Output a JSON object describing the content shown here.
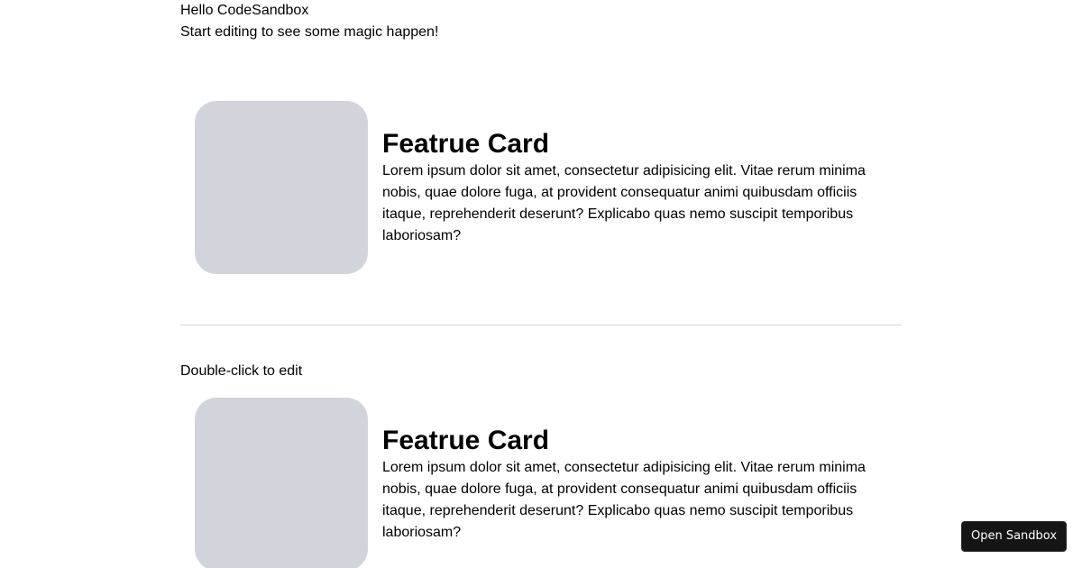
{
  "header": {
    "greeting": "Hello CodeSandbox",
    "subtitle": "Start editing to see some magic happen!"
  },
  "cards": [
    {
      "title": "Featrue Card",
      "text": "Lorem ipsum dolor sit amet, consectetur adipisicing elit. Vitae rerum minima nobis, quae dolore fuga, at provident consequatur animi quibusdam officiis itaque, reprehenderit deserunt? Explicabo quas nemo suscipit temporibus laboriosam?"
    },
    {
      "title": "Featrue Card",
      "text": "Lorem ipsum dolor sit amet, consectetur adipisicing elit. Vitae rerum minima nobis, quae dolore fuga, at provident consequatur animi quibusdam officiis itaque, reprehenderit deserunt? Explicabo quas nemo suscipit temporibus laboriosam?"
    }
  ],
  "editor": {
    "hint": "Double-click to edit"
  },
  "sandbox": {
    "open_label": "Open Sandbox"
  },
  "colors": {
    "placeholder": "#d1d5db",
    "divider": "#d1d5db",
    "button_bg": "#151515"
  }
}
